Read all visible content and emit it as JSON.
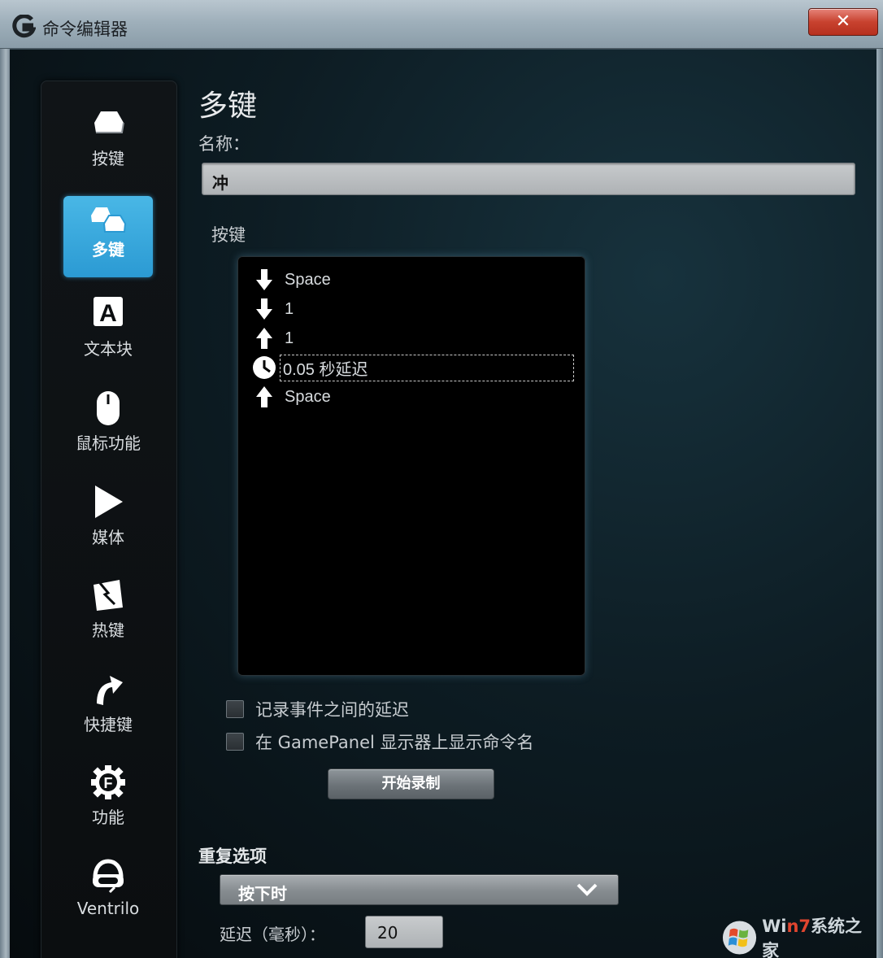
{
  "window": {
    "title": "命令编辑器",
    "close_label": "✕"
  },
  "sidebar": {
    "items": [
      {
        "label": "按键",
        "icon": "key-icon",
        "active": false
      },
      {
        "label": "多键",
        "icon": "multikey-icon",
        "active": true
      },
      {
        "label": "文本块",
        "icon": "text-block-icon",
        "active": false
      },
      {
        "label": "鼠标功能",
        "icon": "mouse-icon",
        "active": false
      },
      {
        "label": "媒体",
        "icon": "play-icon",
        "active": false
      },
      {
        "label": "热键",
        "icon": "hotkey-icon",
        "active": false
      },
      {
        "label": "快捷键",
        "icon": "shortcut-arrow-icon",
        "active": false
      },
      {
        "label": "功能",
        "icon": "function-gear-icon",
        "active": false
      },
      {
        "label": "Ventrilo",
        "icon": "headset-icon",
        "active": false
      }
    ],
    "active_color": "#2b9ad3"
  },
  "main": {
    "title": "多键",
    "name_label": "名称：",
    "name_value": "冲",
    "keys_label": "按键",
    "key_events": [
      {
        "icon": "arrow-down-icon",
        "text": "Space"
      },
      {
        "icon": "arrow-down-icon",
        "text": "1"
      },
      {
        "icon": "arrow-up-icon",
        "text": "1"
      },
      {
        "icon": "clock-icon",
        "text": "0.05 秒延迟",
        "selected": true
      },
      {
        "icon": "arrow-up-icon",
        "text": "Space"
      }
    ],
    "checkboxes": [
      {
        "label": "记录事件之间的延迟",
        "checked": false
      },
      {
        "label": "在 GamePanel 显示器上显示命令名",
        "checked": false
      }
    ],
    "record_button": "开始录制",
    "repeat_label": "重复选项",
    "repeat_value": "按下时",
    "delay_label": "延迟（毫秒）：",
    "delay_value": "20"
  },
  "watermark": {
    "prefix": "Wi",
    "seven": "n7",
    "suffix": "系统之家"
  }
}
